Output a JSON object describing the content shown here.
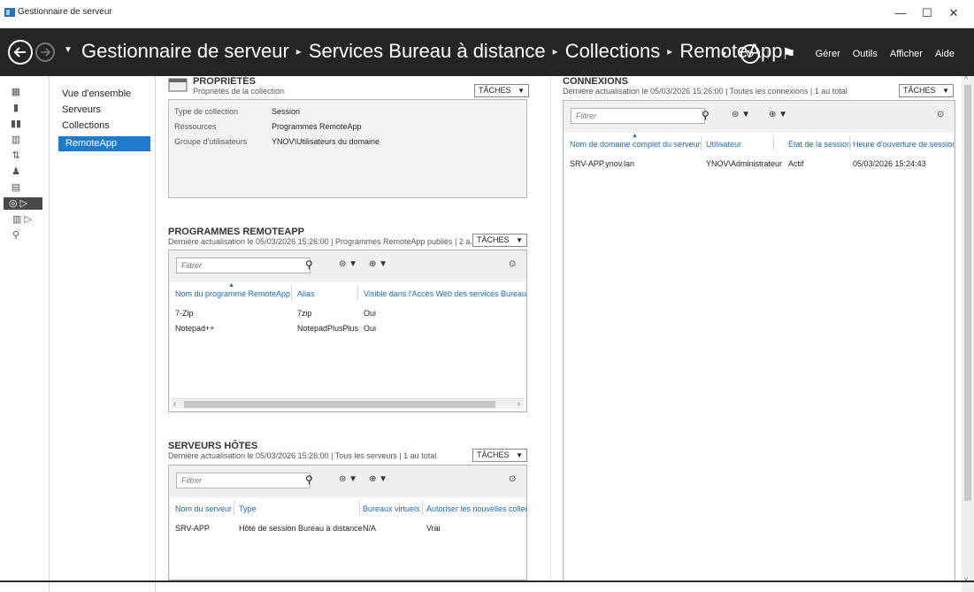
{
  "window": {
    "title": "Gestionnaire de serveur",
    "minimize": "—",
    "maximize": "☐",
    "close": "✕"
  },
  "breadcrumb": [
    "Gestionnaire de serveur",
    "Services Bureau à distance",
    "Collections",
    "RemoteApp"
  ],
  "toolbar": {
    "manage": "Gérer",
    "tools": "Outils",
    "view": "Afficher",
    "help": "Aide"
  },
  "nav": {
    "items": [
      {
        "label": "Vue d'ensemble"
      },
      {
        "label": "Serveurs"
      },
      {
        "label": "Collections"
      },
      {
        "label": "RemoteApp",
        "selected": true
      }
    ]
  },
  "properties": {
    "title": "PROPRIÉTÉS",
    "subtitle": "Propriétés de la collection",
    "tasks": "TÂCHES",
    "rows": [
      {
        "key": "Type de collection",
        "value": "Session"
      },
      {
        "key": "Ressources",
        "value": "Programmes RemoteApp"
      },
      {
        "key": "Groupe d'utilisateurs",
        "value": "YNOV\\Utilisateurs du domaine"
      }
    ]
  },
  "remoteapp": {
    "title": "PROGRAMMES REMOTEAPP",
    "subtitle": "Dernière actualisation le 05/03/2026 15:26:00 | Programmes RemoteApp publiés | 2 a...",
    "tasks": "TÂCHES",
    "filter_placeholder": "Filtrer",
    "columns": [
      "Nom du programme RemoteApp",
      "Alias",
      "Visible dans l'Accès Web des services Bureau à d"
    ],
    "rows": [
      [
        "7-Zip",
        "7zip",
        "Oui"
      ],
      [
        "Notepad++",
        "NotepadPlusPlus",
        "Oui"
      ]
    ]
  },
  "hosts": {
    "title": "SERVEURS HÔTES",
    "subtitle": "Dernière actualisation le 05/03/2026 15:26:00 | Tous les serveurs | 1 au total",
    "tasks": "TÂCHES",
    "filter_placeholder": "Filtrer",
    "columns": [
      "Nom du serveur",
      "Type",
      "Bureaux virtuels",
      "Autoriser les nouvelles collect"
    ],
    "rows": [
      [
        "SRV-APP",
        "Hôte de session Bureau à distance",
        "N/A",
        "Vrai"
      ]
    ]
  },
  "connections": {
    "title": "CONNEXIONS",
    "subtitle": "Dernière actualisation le 05/03/2026 15:26:00 | Toutes les connexions | 1 au total",
    "tasks": "TÂCHES",
    "filter_placeholder": "Filtrer",
    "columns": [
      "Nom de domaine complet du serveur",
      "Utilisateur",
      "État de la session",
      "Heure d'ouverture de session"
    ],
    "rows": [
      [
        "SRV-APP.ynov.lan",
        "YNOV\\Administrateur",
        "Actif",
        "05/03/2026 15:24:43"
      ]
    ]
  },
  "colors": {
    "accent": "#1e7acc",
    "navbar": "#252525",
    "link": "#1b6bb5"
  }
}
